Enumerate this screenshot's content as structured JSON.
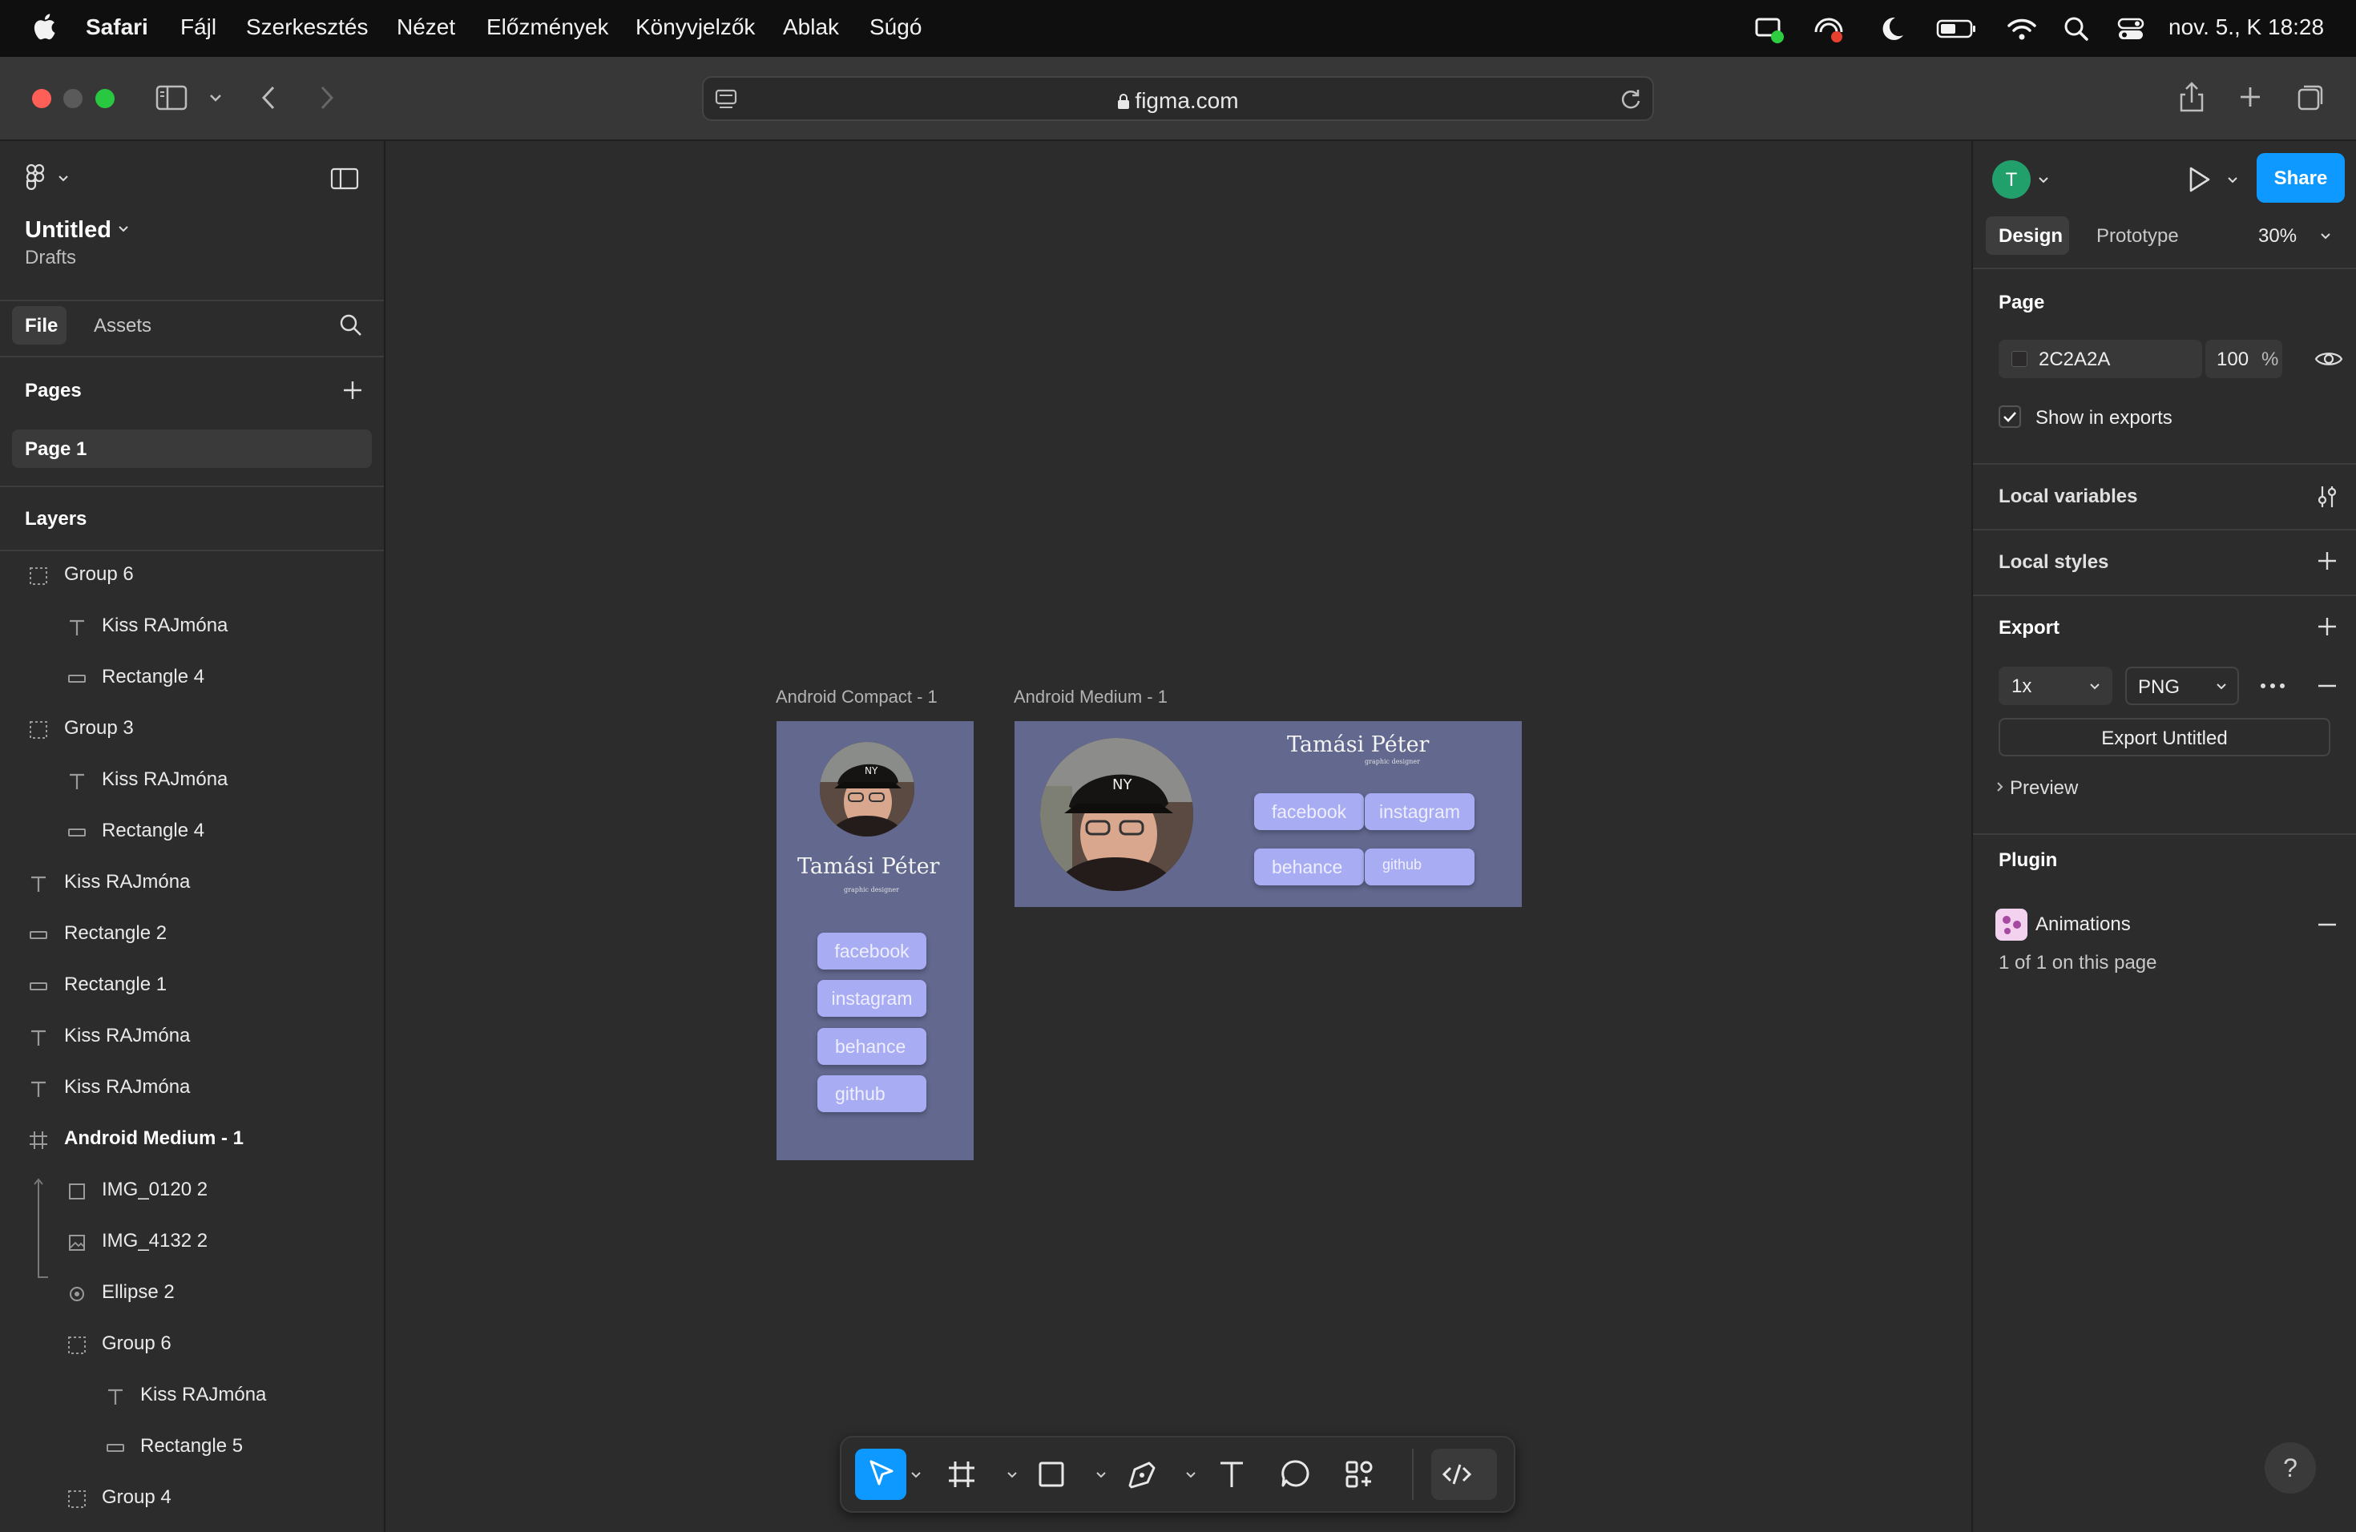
{
  "menubar": {
    "items": [
      "Safari",
      "Fájl",
      "Szerkesztés",
      "Nézet",
      "Előzmények",
      "Könyvjelzők",
      "Ablak",
      "Súgó"
    ],
    "clock": "nov. 5., K  18:28"
  },
  "safari": {
    "url": "figma.com"
  },
  "left_panel": {
    "file_name": "Untitled",
    "location": "Drafts",
    "tabs": [
      "File",
      "Assets"
    ],
    "pages_header": "Pages",
    "pages": [
      "Page 1"
    ],
    "layers_header": "Layers",
    "layers": [
      {
        "name": "Group 6",
        "icon": "group-icon"
      },
      {
        "name": "Kiss RAJmóna",
        "icon": "text-icon"
      },
      {
        "name": "Rectangle 4",
        "icon": "rectangle-icon"
      },
      {
        "name": "Group 3",
        "icon": "group-icon"
      },
      {
        "name": "Kiss RAJmóna",
        "icon": "text-icon"
      },
      {
        "name": "Rectangle 4",
        "icon": "rectangle-icon"
      },
      {
        "name": "Kiss RAJmóna",
        "icon": "text-icon"
      },
      {
        "name": "Rectangle 2",
        "icon": "rectangle-icon"
      },
      {
        "name": "Rectangle 1",
        "icon": "rectangle-icon"
      },
      {
        "name": "Kiss RAJmóna",
        "icon": "text-icon"
      },
      {
        "name": "Kiss RAJmóna",
        "icon": "text-icon"
      },
      {
        "name": "Android Medium - 1",
        "icon": "frame-icon"
      },
      {
        "name": "IMG_0120 2",
        "icon": "rectangle-outline-icon"
      },
      {
        "name": "IMG_4132 2",
        "icon": "image-icon"
      },
      {
        "name": "Ellipse 2",
        "icon": "ellipse-icon"
      },
      {
        "name": "Group 6",
        "icon": "group-icon"
      },
      {
        "name": "Kiss RAJmóna",
        "icon": "text-icon"
      },
      {
        "name": "Rectangle 5",
        "icon": "rectangle-icon"
      },
      {
        "name": "Group 4",
        "icon": "group-icon"
      }
    ]
  },
  "canvas": {
    "frame1": {
      "label": "Android Compact - 1",
      "name": "Tamási Péter",
      "subtitle": "graphic designer",
      "buttons": [
        "facebook",
        "instagram",
        "behance",
        "github"
      ]
    },
    "frame2": {
      "label": "Android Medium - 1",
      "name": "Tamási Péter",
      "subtitle": "graphic designer",
      "buttons": [
        "facebook",
        "instagram",
        "behance",
        "github"
      ]
    },
    "frame_color": "#62688e",
    "button_color": "#a8acf2"
  },
  "right_panel": {
    "avatar_initial": "T",
    "share_label": "Share",
    "tabs": [
      "Design",
      "Prototype"
    ],
    "zoom": "30%",
    "page_section": "Page",
    "page_color": "2C2A2A",
    "page_opacity": "100",
    "percent": "%",
    "show_in_exports": "Show in exports",
    "local_variables": "Local variables",
    "local_styles": "Local styles",
    "export_section": "Export",
    "export_scale": "1x",
    "export_format": "PNG",
    "export_button": "Export Untitled",
    "preview": "Preview",
    "plugin_section": "Plugin",
    "plugin_name": "Animations",
    "plugin_info": "1 of 1 on this page"
  },
  "help": "?"
}
